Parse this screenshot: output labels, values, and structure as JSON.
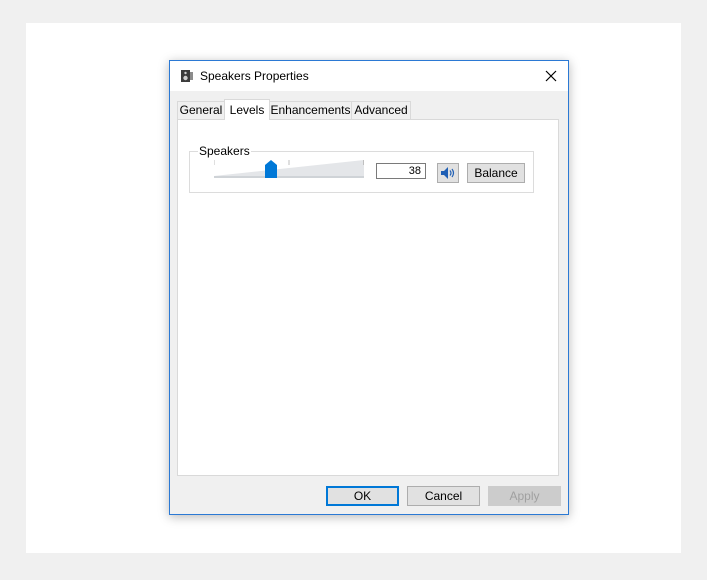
{
  "window": {
    "title": "Speakers Properties",
    "icon": "speaker-device-icon",
    "close_icon": "close-icon"
  },
  "tabs": [
    {
      "label": "General",
      "active": false
    },
    {
      "label": "Levels",
      "active": true
    },
    {
      "label": "Enhancements",
      "active": false
    },
    {
      "label": "Advanced",
      "active": false
    }
  ],
  "levels": {
    "group_label": "Speakers",
    "volume": 38,
    "volume_display": "38",
    "mute_icon": "speaker-volume-icon",
    "balance_label": "Balance"
  },
  "footer": {
    "ok_label": "OK",
    "cancel_label": "Cancel",
    "apply_label": "Apply"
  },
  "colors": {
    "accent": "#0078d7",
    "window_border": "#2b79d4"
  }
}
